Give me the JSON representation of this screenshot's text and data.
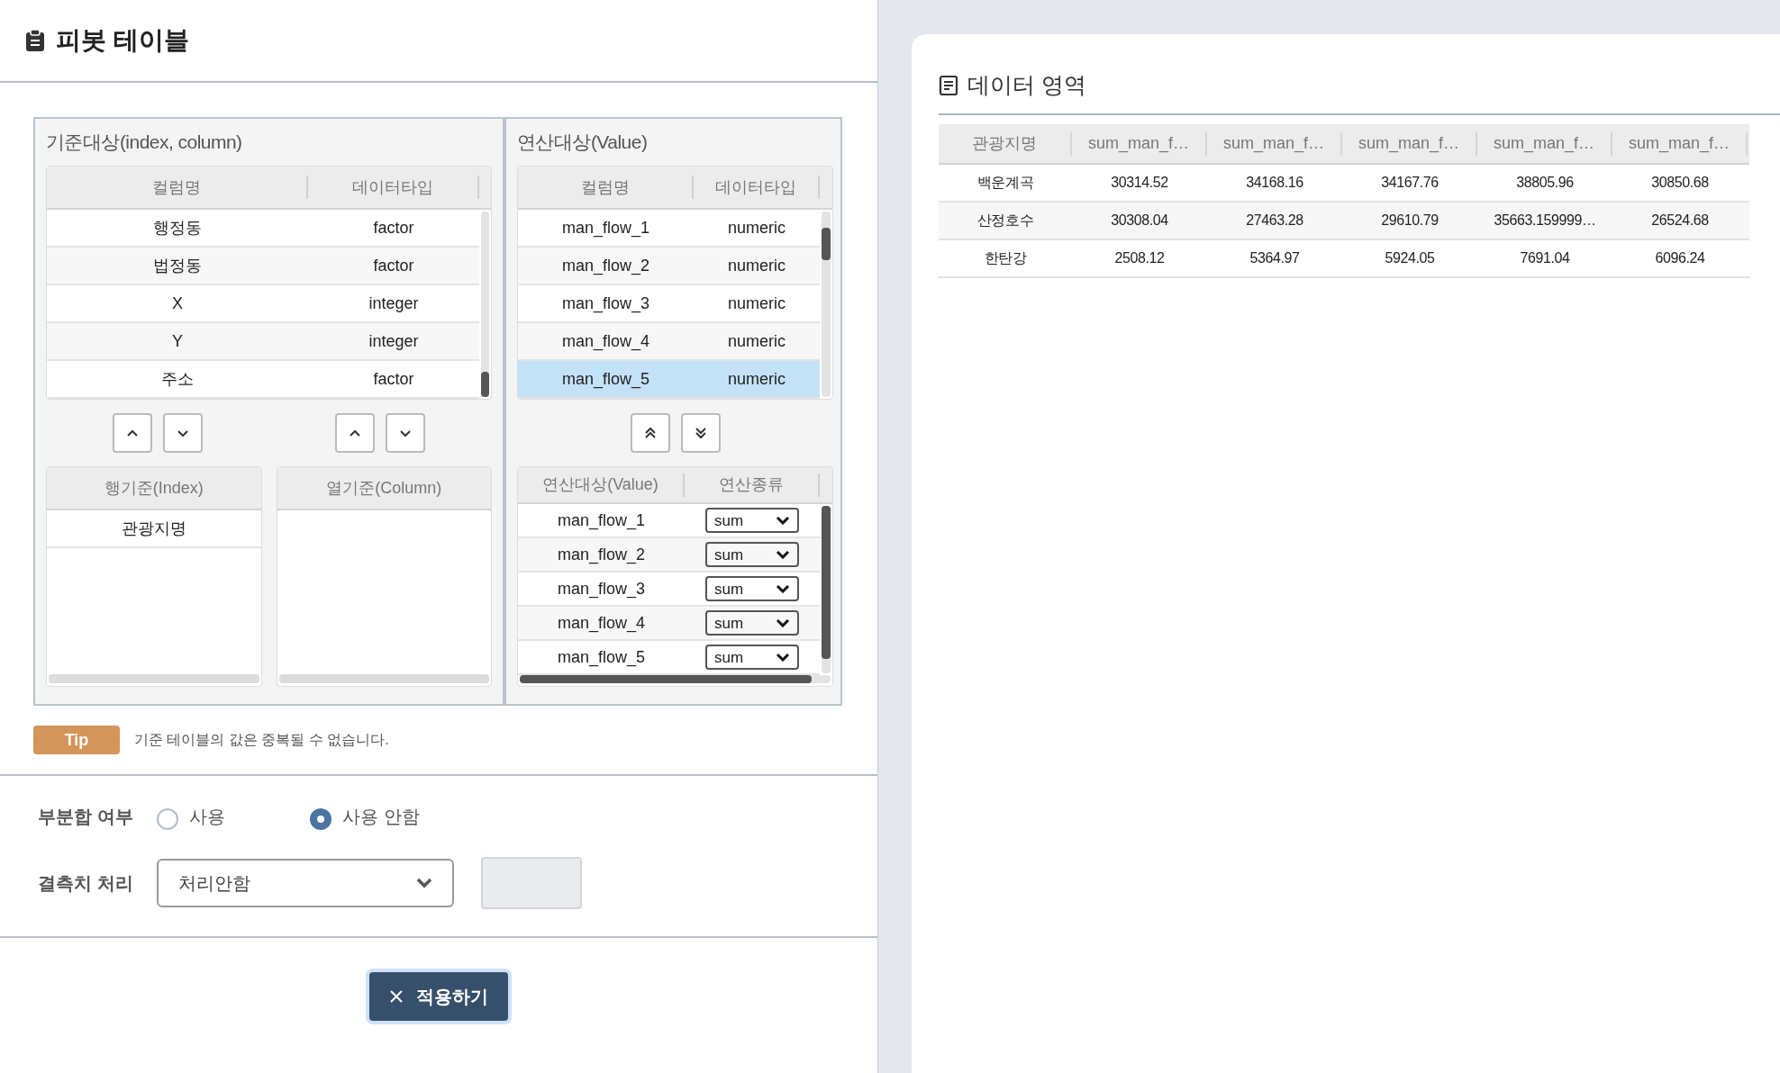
{
  "header": {
    "title": "피봇 테이블"
  },
  "source": {
    "title": "기준대상(index, column)",
    "columns": [
      "컬럼명",
      "데이터타입"
    ],
    "rows": [
      {
        "name": "행정동",
        "type": "factor"
      },
      {
        "name": "법정동",
        "type": "factor"
      },
      {
        "name": "X",
        "type": "integer"
      },
      {
        "name": "Y",
        "type": "integer"
      },
      {
        "name": "주소",
        "type": "factor"
      }
    ]
  },
  "value_source": {
    "title": "연산대상(Value)",
    "columns": [
      "컬럼명",
      "데이터타입"
    ],
    "rows": [
      {
        "name": "man_flow_1",
        "type": "numeric",
        "selected": false
      },
      {
        "name": "man_flow_2",
        "type": "numeric",
        "selected": false
      },
      {
        "name": "man_flow_3",
        "type": "numeric",
        "selected": false
      },
      {
        "name": "man_flow_4",
        "type": "numeric",
        "selected": false
      },
      {
        "name": "man_flow_5",
        "type": "numeric",
        "selected": true
      }
    ]
  },
  "index_box": {
    "title": "행기준(Index)",
    "items": [
      "관광지명"
    ]
  },
  "column_box": {
    "title": "열기준(Column)"
  },
  "value_box": {
    "columns": [
      "연산대상(Value)",
      "연산종류"
    ],
    "rows": [
      {
        "name": "man_flow_1",
        "op": "sum"
      },
      {
        "name": "man_flow_2",
        "op": "sum"
      },
      {
        "name": "man_flow_3",
        "op": "sum"
      },
      {
        "name": "man_flow_4",
        "op": "sum"
      },
      {
        "name": "man_flow_5",
        "op": "sum"
      }
    ]
  },
  "tip": {
    "badge": "Tip",
    "text": "기준 테이블의 값은 중복될 수 없습니다."
  },
  "subtotal": {
    "label": "부분합 여부",
    "options": [
      {
        "label": "사용",
        "selected": false
      },
      {
        "label": "사용 안함",
        "selected": true
      }
    ]
  },
  "missing": {
    "label": "결측치 처리",
    "value": "처리안함"
  },
  "apply_button": "적용하기",
  "data_area": {
    "title": "데이터 영역",
    "columns": [
      "관광지명",
      "sum_man_f…",
      "sum_man_f…",
      "sum_man_f…",
      "sum_man_f…",
      "sum_man_f…"
    ],
    "rows": [
      [
        "백운계곡",
        "30314.52",
        "34168.16",
        "34167.76",
        "38805.96",
        "30850.68"
      ],
      [
        "산정호수",
        "30308.04",
        "27463.28",
        "29610.79",
        "35663.159999…",
        "26524.68"
      ],
      [
        "한탄강",
        "2508.12",
        "5364.97",
        "5924.05",
        "7691.04",
        "6096.24"
      ]
    ]
  }
}
